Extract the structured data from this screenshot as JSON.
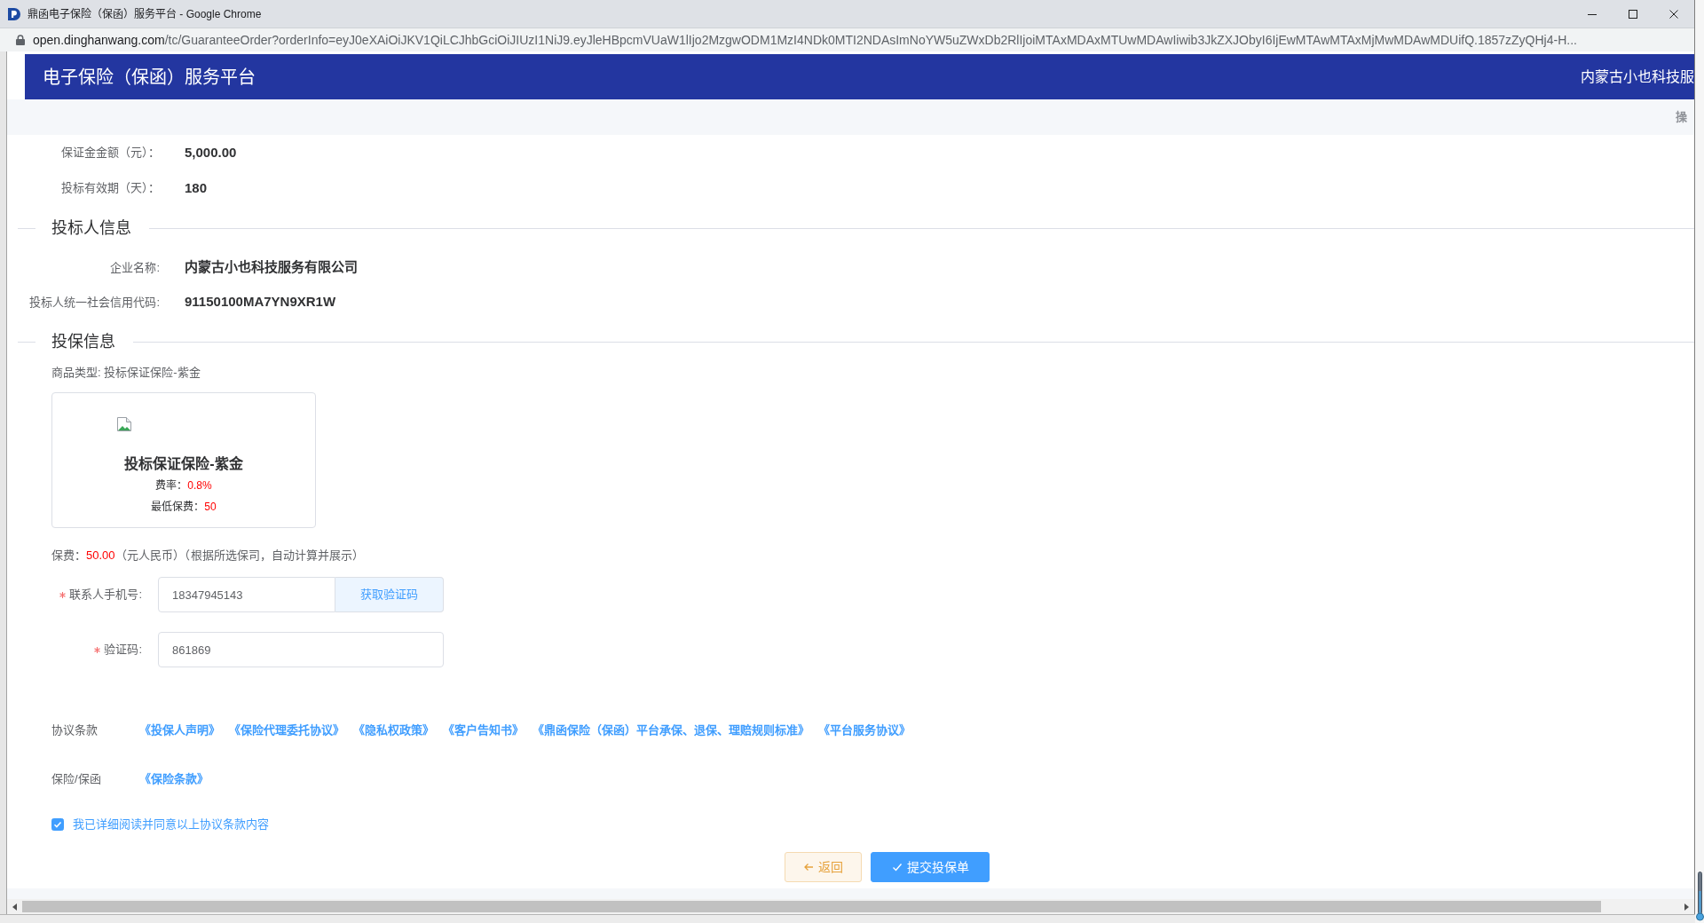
{
  "browser": {
    "title": "鼎函电子保险（保函）服务平台 - Google Chrome",
    "url_host": "open.dinghanwang.com",
    "url_rest": "/tc/GuaranteeOrder?orderInfo=eyJ0eXAiOiJKV1QiLCJhbGciOiJIUzI1NiJ9.eyJleHBpcmVUaW1lIjo2MzgwODM1MzI4NDk0MTI2NDAsImNoYW5uZWxDb2RlIjoiMTAxMDAxMTUwMDAwIiwib3JkZXJObyI6IjEwMTAwMTAxMjMwMDAwMDUifQ.1857zZyQHj4-H..."
  },
  "header": {
    "title": "电子保险（保函）服务平台",
    "company": "内蒙古小也科技服"
  },
  "toolbar": {
    "column_1": "操"
  },
  "guarantee": [
    {
      "label": "保证金金额（元）：",
      "value": "5,000.00"
    },
    {
      "label": "投标有效期（天）：",
      "value": "180"
    }
  ],
  "bidder": {
    "title": "投标人信息",
    "fields": [
      {
        "label": "企业名称:",
        "value": "内蒙古小也科技服务有限公司"
      },
      {
        "label": "投标人统一社会信用代码:",
        "value": "91150100MA7YN9XR1W"
      }
    ]
  },
  "insurance": {
    "title": "投保信息",
    "product_type": "商品类型: 投标保证保险-紫金",
    "product": {
      "name": "投标保证保险-紫金",
      "rate_label": "费率：",
      "rate": "0.8%",
      "min_fee_label": "最低保费：",
      "min_fee": "50"
    },
    "premium": {
      "label": "保费：",
      "amount": "50.00",
      "note": "（元人民币）（根据所选保司，自动计算并展示）"
    },
    "contact_fields": [
      {
        "kind": "phone",
        "required": true,
        "label": "联系人手机号:",
        "value": "18347945143",
        "button": "获取验证码"
      },
      {
        "kind": "code",
        "required": true,
        "label": "验证码:",
        "value": "861869"
      }
    ],
    "agreements": [
      {
        "label": "协议条款",
        "links": [
          "《投保人声明》",
          "《保险代理委托协议》",
          "《隐私权政策》",
          "《客户告知书》",
          "《鼎函保险（保函）平台承保、退保、理赔规则标准》",
          "《平台服务协议》"
        ]
      },
      {
        "label": "保险/保函",
        "links": [
          "《保险条款》"
        ]
      }
    ],
    "consent": {
      "checked": true,
      "text": "我已详细阅读并同意以上协议条款内容"
    }
  },
  "actions": [
    {
      "kind": "back",
      "label": "返回"
    },
    {
      "kind": "submit",
      "label": "提交投保单"
    }
  ]
}
